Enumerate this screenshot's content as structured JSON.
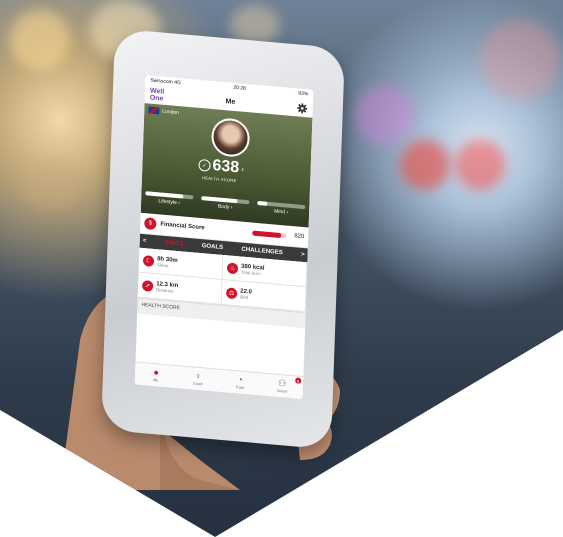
{
  "status_bar": {
    "carrier": "Swisscom 4G",
    "time": "20:28",
    "battery": "93%"
  },
  "app_bar": {
    "logo_line1": "Well",
    "logo_line2": "One",
    "title": "Me",
    "settings_icon": "gear-icon"
  },
  "hero": {
    "location": "London",
    "health_score": "638",
    "health_score_label": "HEALTH SCORE",
    "pillars": [
      {
        "label": "Lifestyle",
        "level": 0.8
      },
      {
        "label": "Body",
        "level": 0.75
      },
      {
        "label": "Mind",
        "level": 0.2
      }
    ]
  },
  "financial": {
    "label": "Financial Score",
    "value": "820",
    "level": 0.85
  },
  "tabs": {
    "prev": "<",
    "active": "STATS",
    "goals": "GOALS",
    "challenges": "CHALLENGES",
    "next": ">"
  },
  "stats": [
    {
      "value": "8h 30m",
      "label": "Sleep",
      "icon": "sleep-icon"
    },
    {
      "value": "380 kcal",
      "label": "Total burn",
      "icon": "flame-icon"
    },
    {
      "value": "12.3 km",
      "label": "Distance",
      "icon": "distance-icon"
    },
    {
      "value": "22.0",
      "label": "BMI",
      "icon": "scale-icon"
    }
  ],
  "section_title": "HEALTH SCORE",
  "bottom_nav": [
    {
      "label": "Me",
      "icon": "person-icon"
    },
    {
      "label": "Coach",
      "icon": "coach-icon"
    },
    {
      "label": "Track",
      "icon": "stopwatch-icon"
    },
    {
      "label": "Social",
      "icon": "social-icon",
      "badge": "6"
    }
  ],
  "colors": {
    "accent": "#d0142c",
    "brand": "#7a3fb5"
  }
}
